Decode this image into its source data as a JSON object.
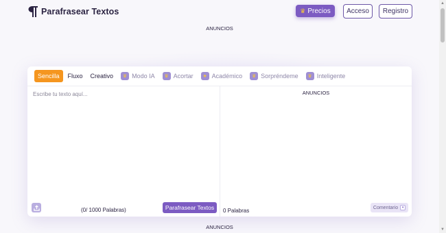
{
  "app": {
    "title": "Parafrasear Textos"
  },
  "header": {
    "precios_label": "Precios",
    "acceso_label": "Acceso",
    "registro_label": "Registro"
  },
  "ads": {
    "top": "ANUNCIOS",
    "card": "ANUNCIOS",
    "bottom": "ANUNCIOS"
  },
  "modes": [
    {
      "label": "Sencilla",
      "active": true,
      "locked": false
    },
    {
      "label": "Fluxo",
      "active": false,
      "locked": false
    },
    {
      "label": "Creativo",
      "active": false,
      "locked": false
    },
    {
      "label": "Modo IA",
      "active": false,
      "locked": true,
      "icon": "robot-icon"
    },
    {
      "label": "Acortar",
      "active": false,
      "locked": true,
      "icon": "shorten-icon"
    },
    {
      "label": "Académico",
      "active": false,
      "locked": true,
      "icon": "academic-icon"
    },
    {
      "label": "Sorpréndeme",
      "active": false,
      "locked": true,
      "icon": "surprise-icon"
    },
    {
      "label": "Inteligente",
      "active": false,
      "locked": true,
      "icon": "smart-icon"
    }
  ],
  "editor": {
    "placeholder": "Escribe tu texto aquí...",
    "value": "",
    "word_count": "(0/ 1000 Palabras)",
    "submit_label": "Parafrasear Textos"
  },
  "output": {
    "word_count": "0 Palabras",
    "comment_label": "Comentario"
  },
  "colors": {
    "accent": "#7c5bc2",
    "active_mode": "#f5961f",
    "crown": "#f4c33f"
  }
}
